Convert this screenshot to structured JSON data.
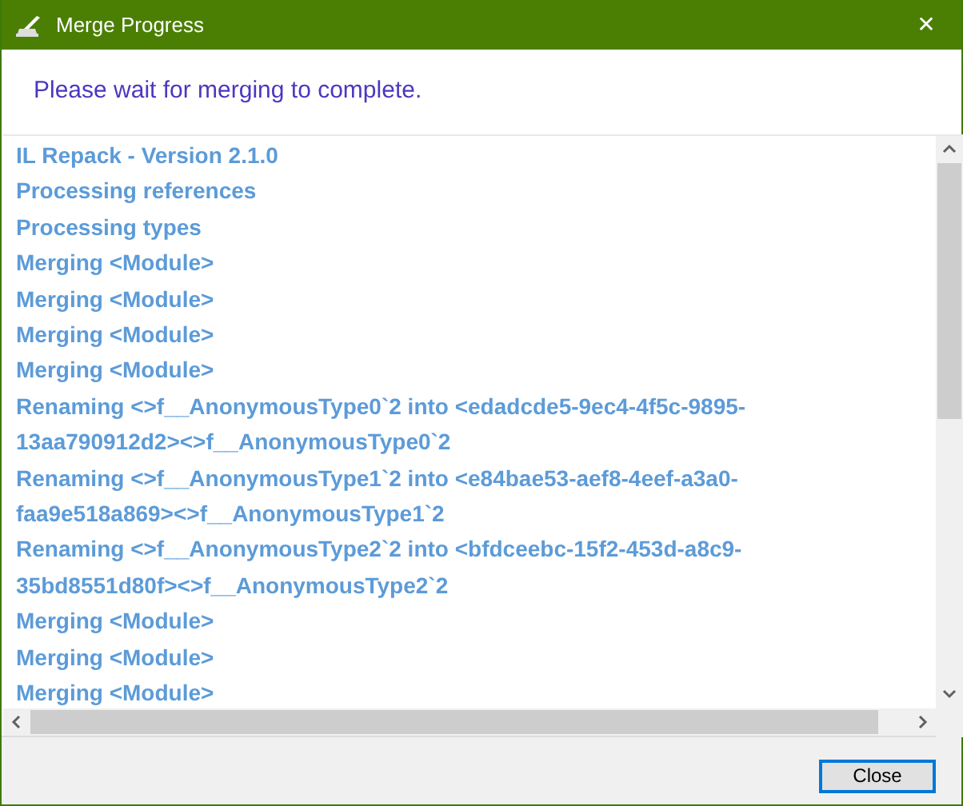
{
  "window": {
    "title": "Merge Progress",
    "close_glyph": "✕"
  },
  "message": "Please wait for merging to complete.",
  "log": [
    "IL Repack - Version 2.1.0",
    "Processing references",
    "Processing types",
    "Merging <Module>",
    "Merging <Module>",
    "Merging <Module>",
    "Merging <Module>",
    "Renaming <>f__AnonymousType0`2 into <edadcde5-9ec4-4f5c-9895-13aa790912d2><>f__AnonymousType0`2",
    "Renaming <>f__AnonymousType1`2 into <e84bae53-aef8-4eef-a3a0-faa9e518a869><>f__AnonymousType1`2",
    "Renaming <>f__AnonymousType2`2 into <bfdceebc-15f2-453d-a8c9-35bd8551d80f><>f__AnonymousType2`2",
    "Merging <Module>",
    "Merging <Module>",
    "Merging <Module>"
  ],
  "buttons": [
    {
      "label": "Close",
      "focused": true
    }
  ]
}
